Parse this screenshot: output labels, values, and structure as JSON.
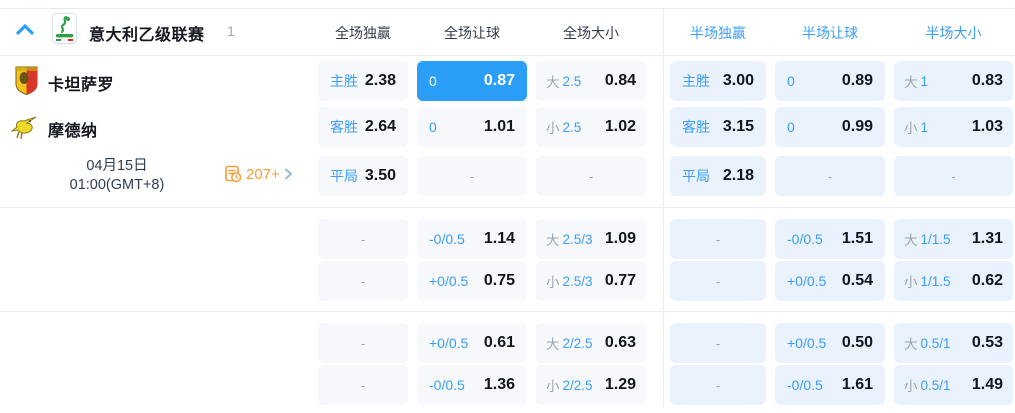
{
  "colors": {
    "accent_blue": "#2b9ff7",
    "label_blue": "#3d9df6",
    "muted_gray": "#9ba7b4",
    "odds_dark": "#11161d",
    "date_navy": "#2c3d52",
    "orange": "#f79d3c",
    "fulltime_cell_bg": "#f6f8fb",
    "halftime_cell_bg": "#e9f2fd"
  },
  "header": {
    "league": "意大利乙级联赛",
    "count": "1",
    "columns": {
      "ft_1x2": "全场独赢",
      "ft_handicap": "全场让球",
      "ft_ou": "全场大小",
      "ht_1x2": "半场独赢",
      "ht_handicap": "半场让球",
      "ht_ou": "半场大小"
    }
  },
  "match": {
    "home_team": "卡坦萨罗",
    "away_team": "摩德纳",
    "date": "04月15日",
    "time": "01:00(GMT+8)",
    "more_markets": "207+"
  },
  "odds": {
    "r1": {
      "c1": {
        "label": "主胜",
        "value": "2.38"
      },
      "c2": {
        "label": "0",
        "value": "0.87"
      },
      "c3": {
        "prefix": "大",
        "line": "2.5",
        "value": "0.84"
      },
      "c4": {
        "label": "主胜",
        "value": "3.00"
      },
      "c5": {
        "label": "0",
        "value": "0.89"
      },
      "c6": {
        "prefix": "大",
        "line": "1",
        "value": "0.83"
      }
    },
    "r2": {
      "c1": {
        "label": "客胜",
        "value": "2.64"
      },
      "c2": {
        "label": "0",
        "value": "1.01"
      },
      "c3": {
        "prefix": "小",
        "line": "2.5",
        "value": "1.02"
      },
      "c4": {
        "label": "客胜",
        "value": "3.15"
      },
      "c5": {
        "label": "0",
        "value": "0.99"
      },
      "c6": {
        "prefix": "小",
        "line": "1",
        "value": "1.03"
      }
    },
    "r3": {
      "c1": {
        "label": "平局",
        "value": "3.50"
      },
      "c2": {
        "value": "-"
      },
      "c3": {
        "value": "-"
      },
      "c4": {
        "label": "平局",
        "value": "2.18"
      },
      "c5": {
        "value": "-"
      },
      "c6": {
        "value": "-"
      }
    },
    "r4": {
      "c1": {
        "value": "-"
      },
      "c2": {
        "label": "-0/0.5",
        "value": "1.14"
      },
      "c3": {
        "prefix": "大",
        "line": "2.5/3",
        "value": "1.09"
      },
      "c4": {
        "value": "-"
      },
      "c5": {
        "label": "-0/0.5",
        "value": "1.51"
      },
      "c6": {
        "prefix": "大",
        "line": "1/1.5",
        "value": "1.31"
      }
    },
    "r5": {
      "c1": {
        "value": "-"
      },
      "c2": {
        "label": "+0/0.5",
        "value": "0.75"
      },
      "c3": {
        "prefix": "小",
        "line": "2.5/3",
        "value": "0.77"
      },
      "c4": {
        "value": "-"
      },
      "c5": {
        "label": "+0/0.5",
        "value": "0.54"
      },
      "c6": {
        "prefix": "小",
        "line": "1/1.5",
        "value": "0.62"
      }
    },
    "r6": {
      "c1": {
        "value": "-"
      },
      "c2": {
        "label": "+0/0.5",
        "value": "0.61"
      },
      "c3": {
        "prefix": "大",
        "line": "2/2.5",
        "value": "0.63"
      },
      "c4": {
        "value": "-"
      },
      "c5": {
        "label": "+0/0.5",
        "value": "0.50"
      },
      "c6": {
        "prefix": "大",
        "line": "0.5/1",
        "value": "0.53"
      }
    },
    "r7": {
      "c1": {
        "value": "-"
      },
      "c2": {
        "label": "-0/0.5",
        "value": "1.36"
      },
      "c3": {
        "prefix": "小",
        "line": "2/2.5",
        "value": "1.29"
      },
      "c4": {
        "value": "-"
      },
      "c5": {
        "label": "-0/0.5",
        "value": "1.61"
      },
      "c6": {
        "prefix": "小",
        "line": "0.5/1",
        "value": "1.49"
      }
    }
  }
}
